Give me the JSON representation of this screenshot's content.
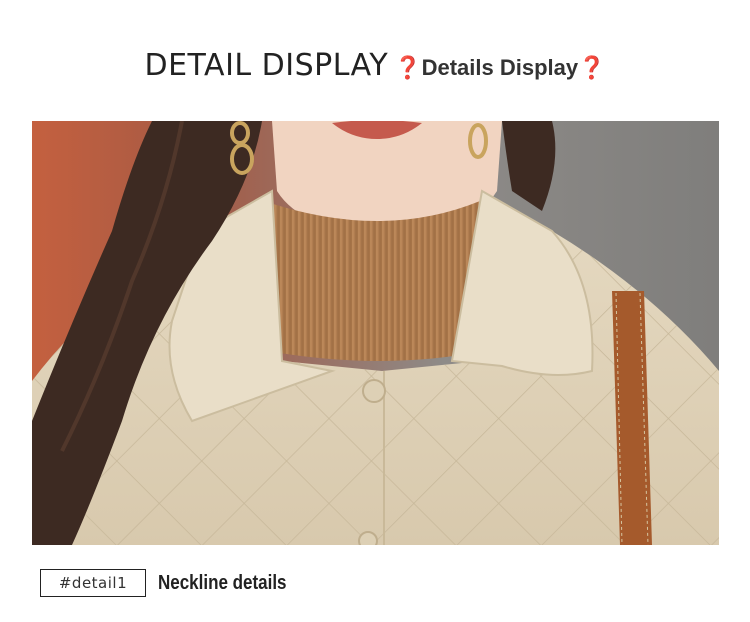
{
  "header": {
    "title_en": "DETAIL DISPLAY",
    "title_zh": "❓Details Display❓"
  },
  "photo": {
    "subject": "model-wearing-quilted-coat"
  },
  "footer": {
    "tag": "#detail1",
    "caption": "Neckline details"
  }
}
